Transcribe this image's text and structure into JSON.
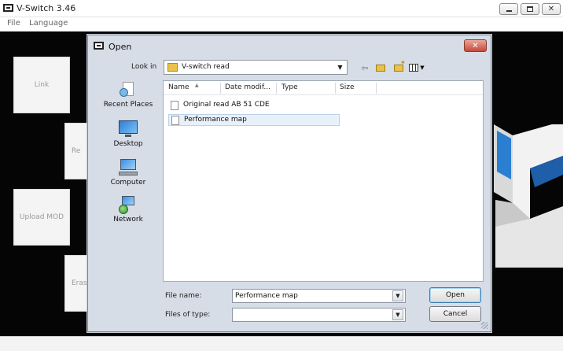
{
  "app": {
    "title": "V-Switch 3.46",
    "menu": [
      "File",
      "Language"
    ]
  },
  "side_buttons": [
    {
      "label": "Link"
    },
    {
      "label": "Re"
    },
    {
      "label": "Upload MOD"
    },
    {
      "label": "Eras"
    }
  ],
  "dialog": {
    "title": "Open",
    "close_label": "✕",
    "look_in_label": "Look in",
    "look_in_value": "V-switch read",
    "places": [
      {
        "label": "Recent Places",
        "icon": "recent-places-icon"
      },
      {
        "label": "Desktop",
        "icon": "desktop-icon"
      },
      {
        "label": "Computer",
        "icon": "computer-icon"
      },
      {
        "label": "Network",
        "icon": "network-icon"
      }
    ],
    "columns": [
      "Name",
      "Date modif...",
      "Type",
      "Size"
    ],
    "files": [
      {
        "name": "Original read AB 51 CDE",
        "selected": false
      },
      {
        "name": "Performance map",
        "selected": true
      }
    ],
    "file_name_label": "File name:",
    "file_name_value": "Performance map",
    "file_type_label": "Files of type:",
    "file_type_value": "",
    "open_label": "Open",
    "cancel_label": "Cancel"
  },
  "colors": {
    "workspace_bg": "#050505",
    "dialog_bg": "#d6dde6",
    "close_button": "#c4493a",
    "selection": "#e8f1fb"
  }
}
